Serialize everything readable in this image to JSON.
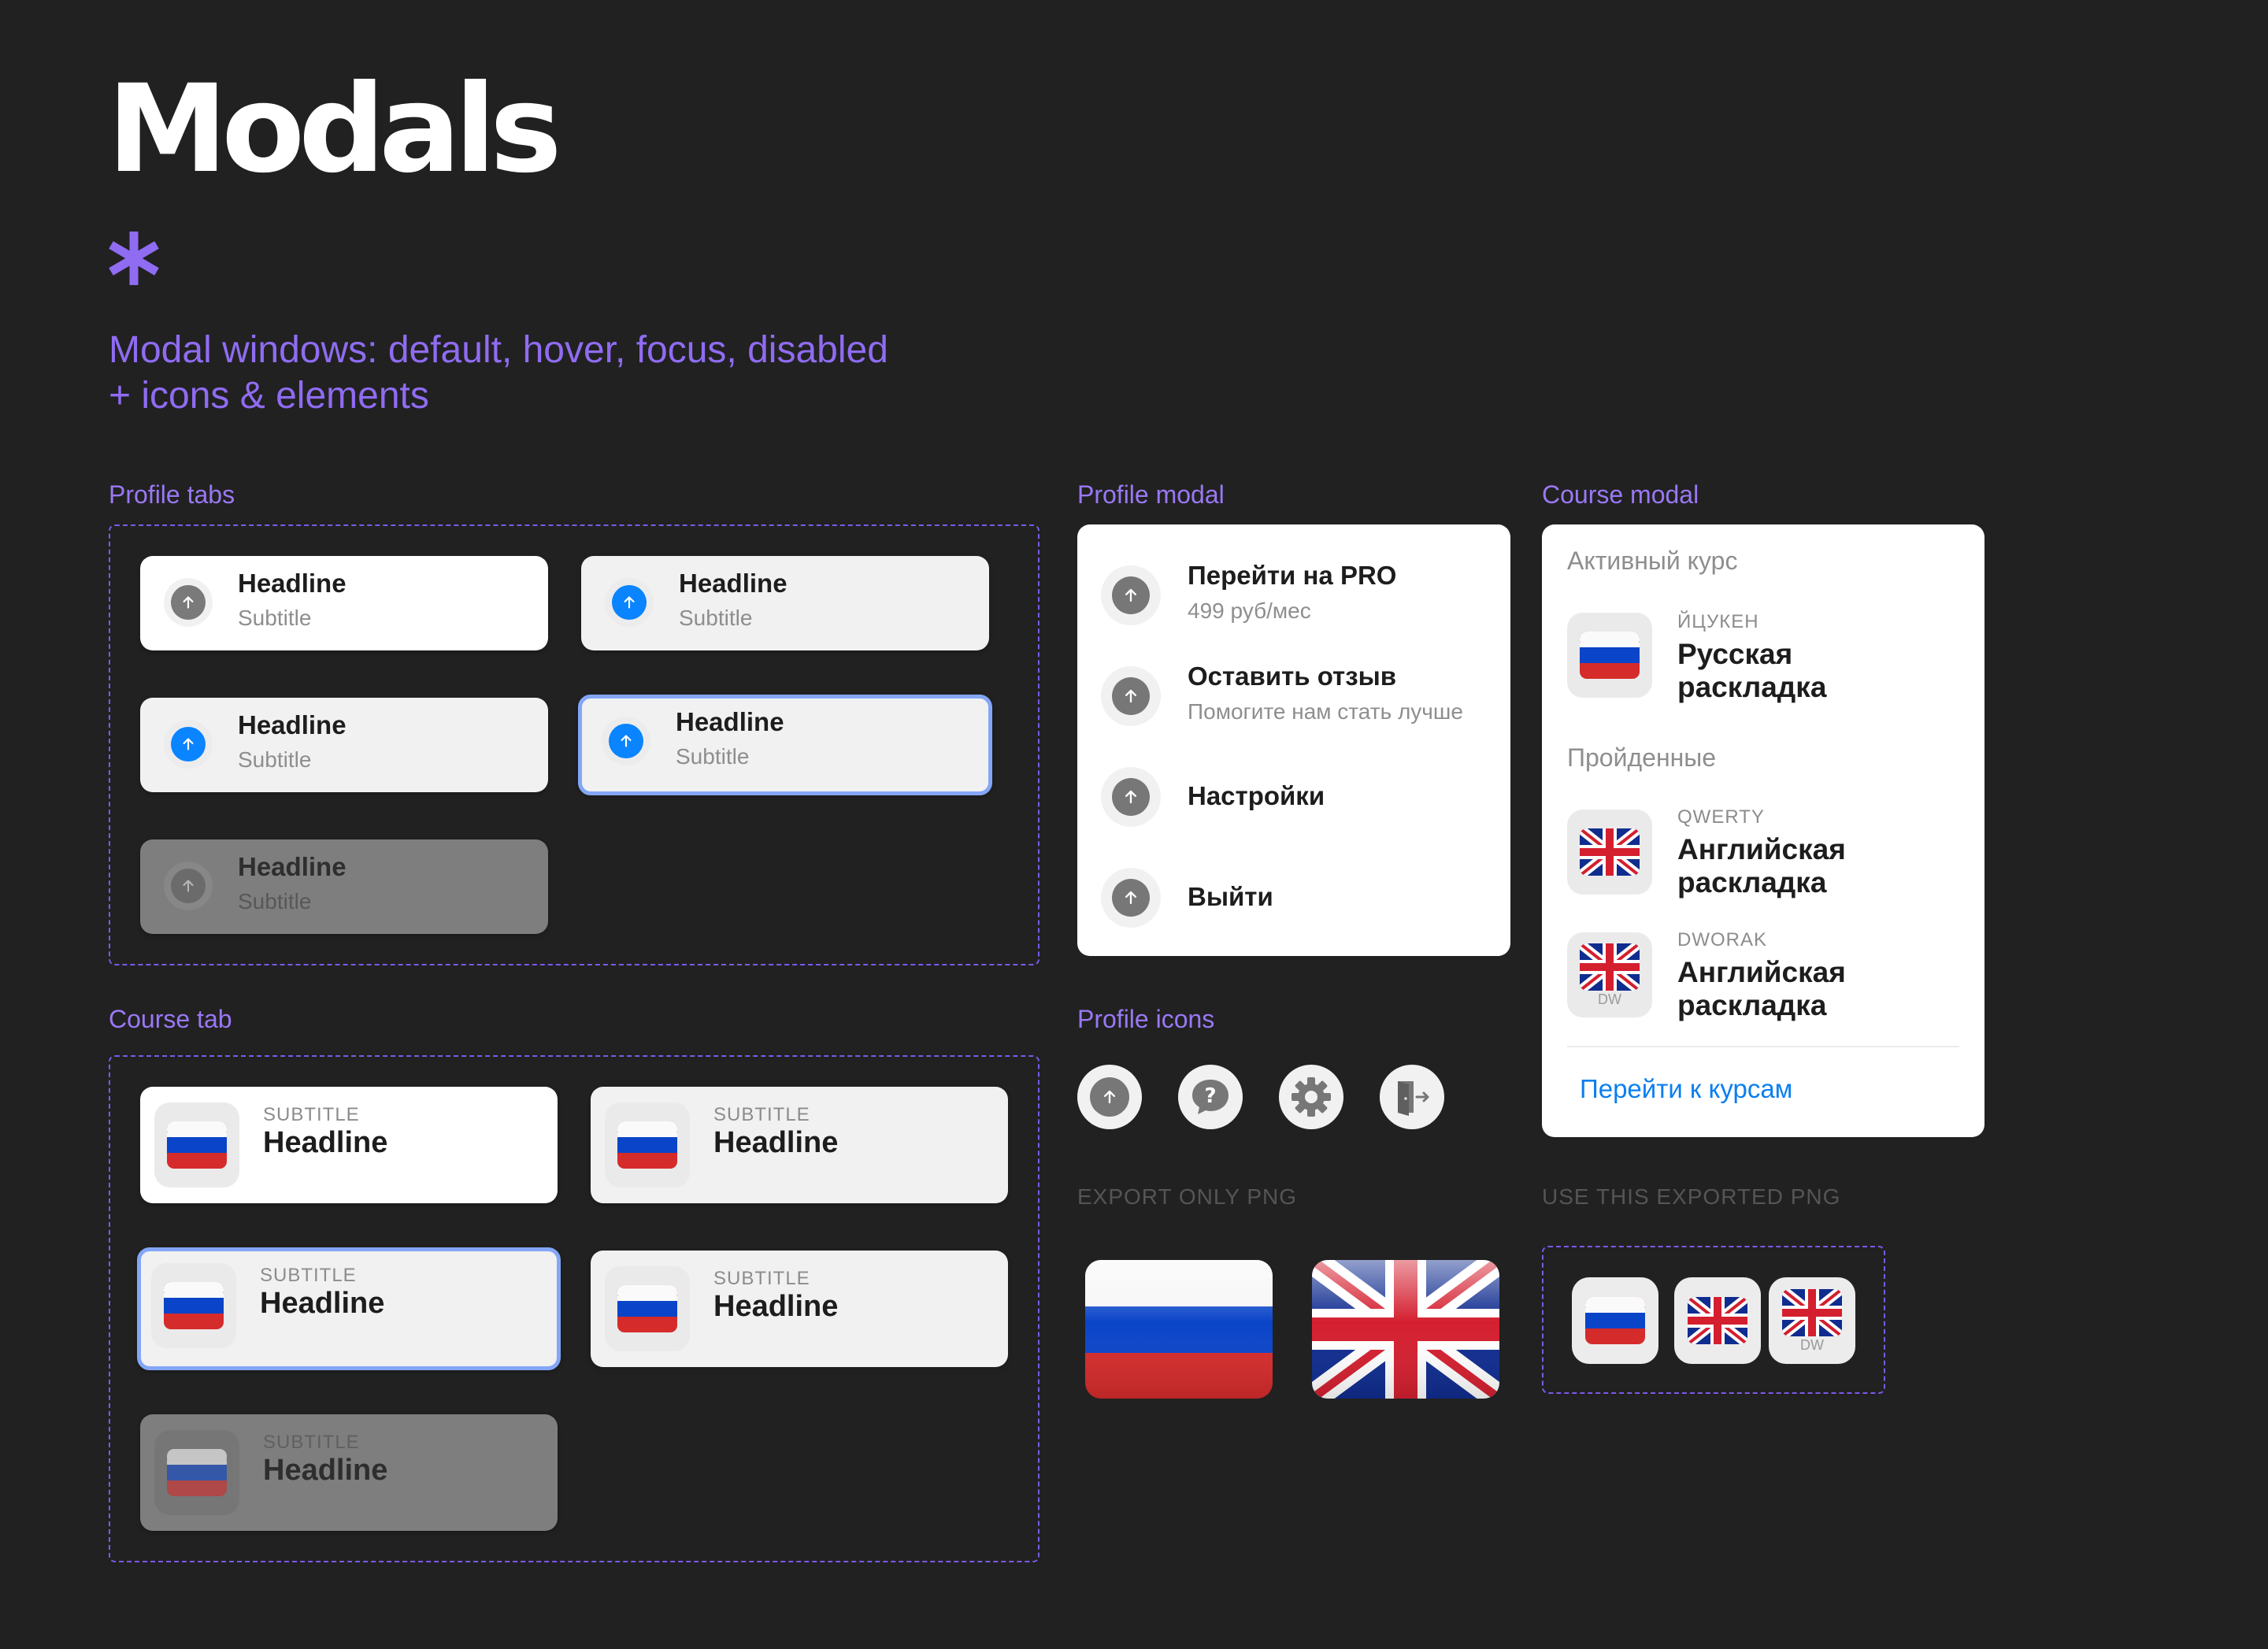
{
  "header": {
    "title": "Modals",
    "description_line1": "Modal windows: default, hover, focus, disabled",
    "description_line2": "+ icons & elements"
  },
  "sections": {
    "profile_tabs": "Profile tabs",
    "course_tab": "Course tab",
    "profile_modal": "Profile modal",
    "course_modal": "Course modal",
    "profile_icons": "Profile icons",
    "export_only_png": "EXPORT ONLY PNG",
    "use_exported_png": "USE THIS EXPORTED PNG"
  },
  "profile_tabs": [
    {
      "state": "default",
      "headline": "Headline",
      "subtitle": "Subtitle"
    },
    {
      "state": "hover",
      "headline": "Headline",
      "subtitle": "Subtitle"
    },
    {
      "state": "hover-blue",
      "headline": "Headline",
      "subtitle": "Subtitle"
    },
    {
      "state": "focus",
      "headline": "Headline",
      "subtitle": "Subtitle"
    },
    {
      "state": "disabled",
      "headline": "Headline",
      "subtitle": "Subtitle"
    }
  ],
  "course_tabs": [
    {
      "state": "default",
      "subtitle": "SUBTITLE",
      "headline": "Headline"
    },
    {
      "state": "hover",
      "subtitle": "SUBTITLE",
      "headline": "Headline"
    },
    {
      "state": "focus",
      "subtitle": "SUBTITLE",
      "headline": "Headline"
    },
    {
      "state": "hover",
      "subtitle": "SUBTITLE",
      "headline": "Headline"
    },
    {
      "state": "disabled",
      "subtitle": "SUBTITLE",
      "headline": "Headline"
    }
  ],
  "profile_modal": {
    "items": [
      {
        "title": "Перейти на PRO",
        "subtitle": "499 руб/мес",
        "icon": "arrow-up-icon"
      },
      {
        "title": "Оставить отзыв",
        "subtitle": "Помогите нам стать лучше",
        "icon": "arrow-up-icon"
      },
      {
        "title": "Настройки",
        "subtitle": "",
        "icon": "arrow-up-icon"
      },
      {
        "title": "Выйти",
        "subtitle": "",
        "icon": "arrow-up-icon"
      }
    ]
  },
  "course_modal": {
    "active_heading": "Активный курс",
    "active": {
      "layout": "ЙЦУКЕН",
      "title_line1": "Русская",
      "title_line2": "раскладка",
      "flag": "ru-flag-icon"
    },
    "completed_heading": "Пройденные",
    "completed": [
      {
        "layout": "QWERTY",
        "title_line1": "Английская",
        "title_line2": "раскладка",
        "flag": "uk-flag-icon"
      },
      {
        "layout": "DWORAK",
        "title_line1": "Английская",
        "title_line2": "раскладка",
        "flag": "uk-flag-dw-icon",
        "badge": "DW"
      }
    ],
    "link": "Перейти к курсам"
  },
  "profile_icons": [
    "arrow-up-icon",
    "chat-question-icon",
    "gear-icon",
    "logout-door-icon"
  ],
  "colors": {
    "background": "#212121",
    "accent": "#8f6cf2",
    "focus_border": "#84a6f7",
    "link": "#0a7ff0",
    "blue_icon": "#0a84ff"
  }
}
